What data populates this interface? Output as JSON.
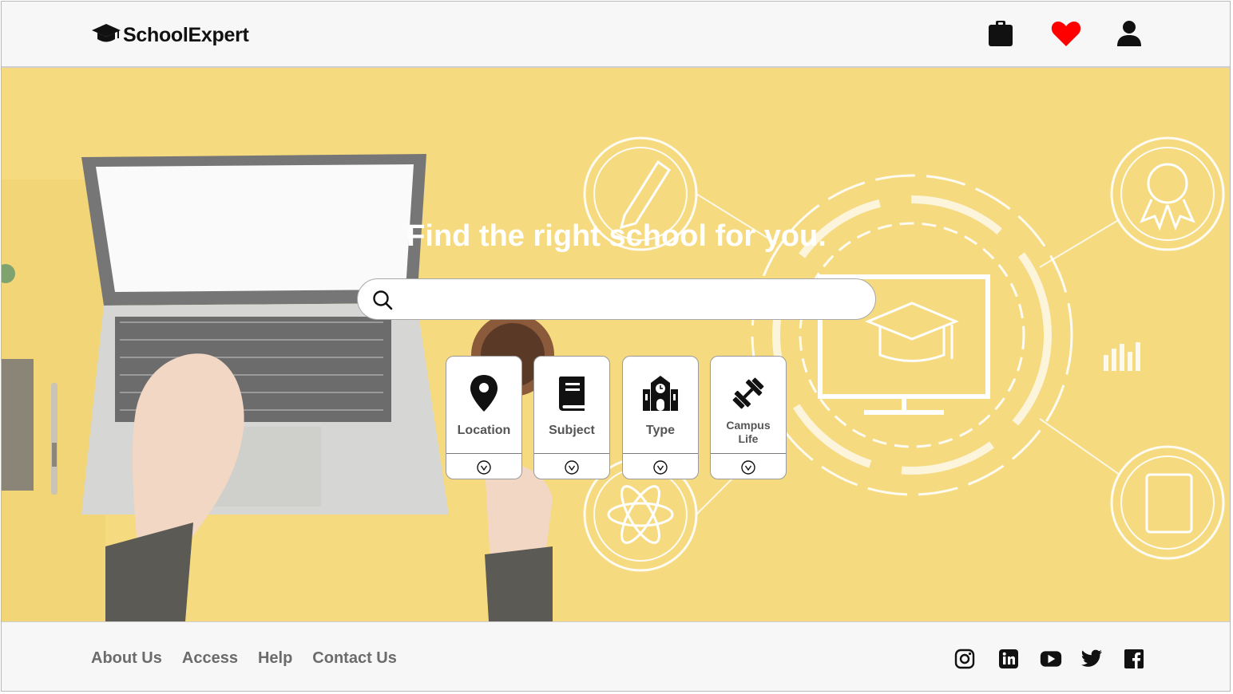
{
  "brand": {
    "name": "SchoolExpert",
    "logo_icon": "graduation-cap-icon"
  },
  "header": {
    "icons": [
      {
        "name": "clipboard-icon",
        "color": "#111111"
      },
      {
        "name": "heart-icon",
        "color": "#ff0000"
      },
      {
        "name": "user-icon",
        "color": "#111111"
      }
    ]
  },
  "hero": {
    "title": "Find the right school for you.",
    "background_color": "#f5da7f",
    "search": {
      "placeholder": "",
      "value": "",
      "icon": "search-icon"
    },
    "categories": [
      {
        "label": "Location",
        "icon": "map-pin-icon",
        "toggle_icon": "chevron-down-icon"
      },
      {
        "label": "Subject",
        "icon": "book-icon",
        "toggle_icon": "chevron-down-icon"
      },
      {
        "label": "Type",
        "icon": "school-building-icon",
        "toggle_icon": "chevron-down-icon"
      },
      {
        "label": "Campus Life",
        "label_line1": "Campus",
        "label_line2": "Life",
        "icon": "dumbbell-icon",
        "toggle_icon": "chevron-down-icon"
      }
    ]
  },
  "footer": {
    "links": [
      "About Us",
      "Access",
      "Help",
      "Contact Us"
    ],
    "social": [
      "instagram-icon",
      "linkedin-icon",
      "youtube-icon",
      "twitter-icon",
      "facebook-icon"
    ]
  }
}
